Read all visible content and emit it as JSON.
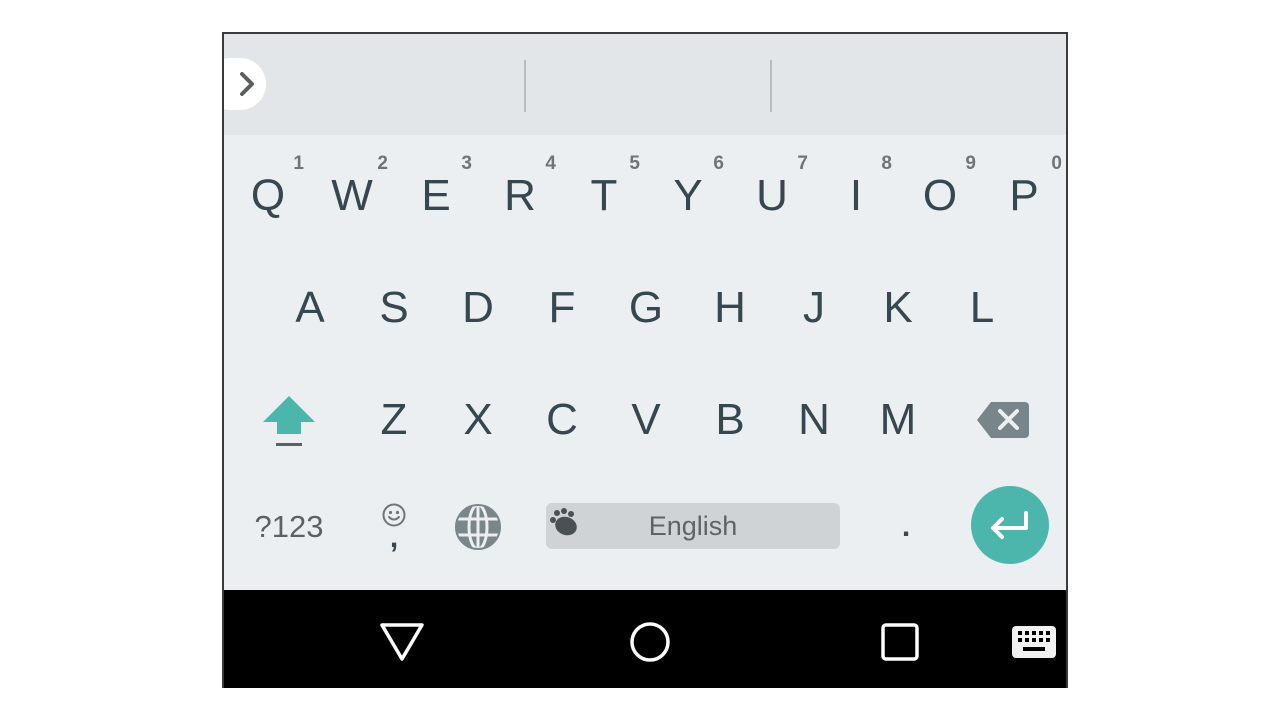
{
  "keyboard": {
    "suggestion_strip": {
      "expand_icon": "chevron-right-icon",
      "suggestions": [
        "",
        "",
        ""
      ]
    },
    "rows": [
      {
        "name": "top-row",
        "keys": [
          {
            "label": "Q",
            "hint": "1"
          },
          {
            "label": "W",
            "hint": "2"
          },
          {
            "label": "E",
            "hint": "3"
          },
          {
            "label": "R",
            "hint": "4"
          },
          {
            "label": "T",
            "hint": "5"
          },
          {
            "label": "Y",
            "hint": "6"
          },
          {
            "label": "U",
            "hint": "7"
          },
          {
            "label": "I",
            "hint": "8"
          },
          {
            "label": "O",
            "hint": "9"
          },
          {
            "label": "P",
            "hint": "0"
          }
        ]
      },
      {
        "name": "home-row",
        "keys": [
          {
            "label": "A"
          },
          {
            "label": "S"
          },
          {
            "label": "D"
          },
          {
            "label": "F"
          },
          {
            "label": "G"
          },
          {
            "label": "H"
          },
          {
            "label": "J"
          },
          {
            "label": "K"
          },
          {
            "label": "L"
          }
        ]
      },
      {
        "name": "bottom-row",
        "keys": [
          {
            "label": "Z"
          },
          {
            "label": "X"
          },
          {
            "label": "C"
          },
          {
            "label": "V"
          },
          {
            "label": "B"
          },
          {
            "label": "N"
          },
          {
            "label": "M"
          }
        ]
      }
    ],
    "shift": {
      "icon": "shift-arrow-icon",
      "state": "active"
    },
    "backspace": {
      "icon": "backspace-icon"
    },
    "symbols_label": "?123",
    "emoji_comma": {
      "icon": "smiley-icon",
      "label": ","
    },
    "language_switch": {
      "icon": "globe-icon"
    },
    "space": {
      "label": "English",
      "icon": "paw-icon"
    },
    "period_label": ".",
    "enter": {
      "icon": "enter-arrow-icon"
    },
    "colors": {
      "accent": "#4db6ac",
      "key_text": "#37474f",
      "background": "#eceff1",
      "suggestion_strip": "#e3e6e8"
    }
  },
  "navigation_bar": {
    "back_icon": "back-triangle-icon",
    "home_icon": "home-circle-icon",
    "recents_icon": "recents-square-icon",
    "keyboard_switch_icon": "keyboard-icon"
  }
}
